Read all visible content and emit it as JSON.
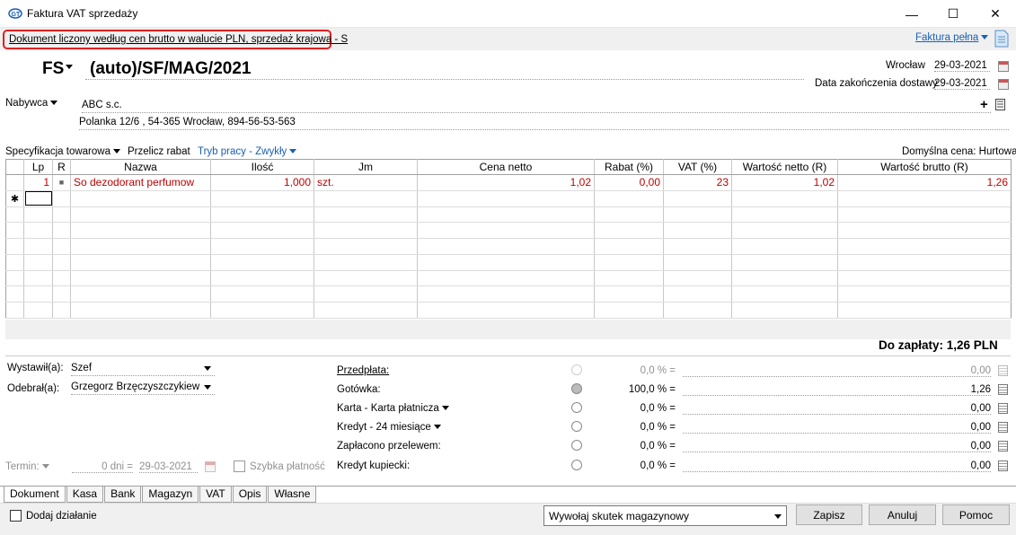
{
  "window": {
    "title": "Faktura VAT sprzedaży",
    "minimize": "—",
    "maximize": "☐",
    "close": "✕"
  },
  "info": {
    "doc_type": "Dokument liczony według cen brutto w walucie PLN, sprzedaż krajowa - S",
    "faktura_pelna": "Faktura pełna"
  },
  "header": {
    "prefix": "FS",
    "number": "(auto)/SF/MAG/2021",
    "city_label": "Wrocław",
    "city_date": "29-03-2021",
    "delivery_label": "Data zakończenia dostawy",
    "delivery_date": "29-03-2021"
  },
  "buyer": {
    "label": "Nabywca",
    "name": "ABC s.c.",
    "address": "Polanka  12/6 , 54-365 Wrocław, 894-56-53-563"
  },
  "toolbar": {
    "spec": "Specyfikacja towarowa",
    "recalc": "Przelicz rabat",
    "mode": "Tryb pracy - Zwykły",
    "default_price": "Domyślna cena: Hurtowa"
  },
  "grid": {
    "columns": [
      "Lp",
      "R",
      "Nazwa",
      "Ilość",
      "Jm",
      "Cena netto",
      "Rabat (%)",
      "VAT (%)",
      "Wartość netto (R)",
      "Wartość brutto (R)"
    ],
    "rows": [
      {
        "lp": "1",
        "r": "■",
        "nazwa": "So dezodorant perfumow",
        "ilosc": "1,000",
        "jm": "szt.",
        "cena": "1,02",
        "rabat": "0,00",
        "vat": "23",
        "netto": "1,02",
        "brutto": "1,26"
      }
    ],
    "new_row_marker": "✱"
  },
  "total": "Do zapłaty: 1,26 PLN",
  "people": {
    "issued_label": "Wystawił(a):",
    "issued_value": "Szef",
    "received_label": "Odebrał(a):",
    "received_value": "Grzegorz Brzęczyszczykiewicz"
  },
  "term": {
    "label": "Termin:",
    "days": "0 dni =",
    "date": "29-03-2021",
    "quick": "Szybka płatność"
  },
  "payments": [
    {
      "label": "Przedpłata:",
      "pct": "0,0 % =",
      "amount": "0,00"
    },
    {
      "label": "Gotówka:",
      "pct": "100,0 % =",
      "amount": "1,26"
    },
    {
      "label": "Karta - Karta płatnicza",
      "pct": "0,0 % =",
      "amount": "0,00"
    },
    {
      "label": "Kredyt - 24 miesiące",
      "pct": "0,0 % =",
      "amount": "0,00"
    },
    {
      "label": "Zapłacono przelewem:",
      "pct": "0,0 % =",
      "amount": "0,00"
    },
    {
      "label": "Kredyt kupiecki:",
      "pct": "0,0 % =",
      "amount": "0,00"
    }
  ],
  "tabs": [
    "Dokument",
    "Kasa",
    "Bank",
    "Magazyn",
    "VAT",
    "Opis",
    "Własne"
  ],
  "bottom": {
    "add_action": "Dodaj działanie",
    "stock_effect": "Wywołaj skutek magazynowy",
    "save": "Zapisz",
    "cancel": "Anuluj",
    "help": "Pomoc"
  }
}
